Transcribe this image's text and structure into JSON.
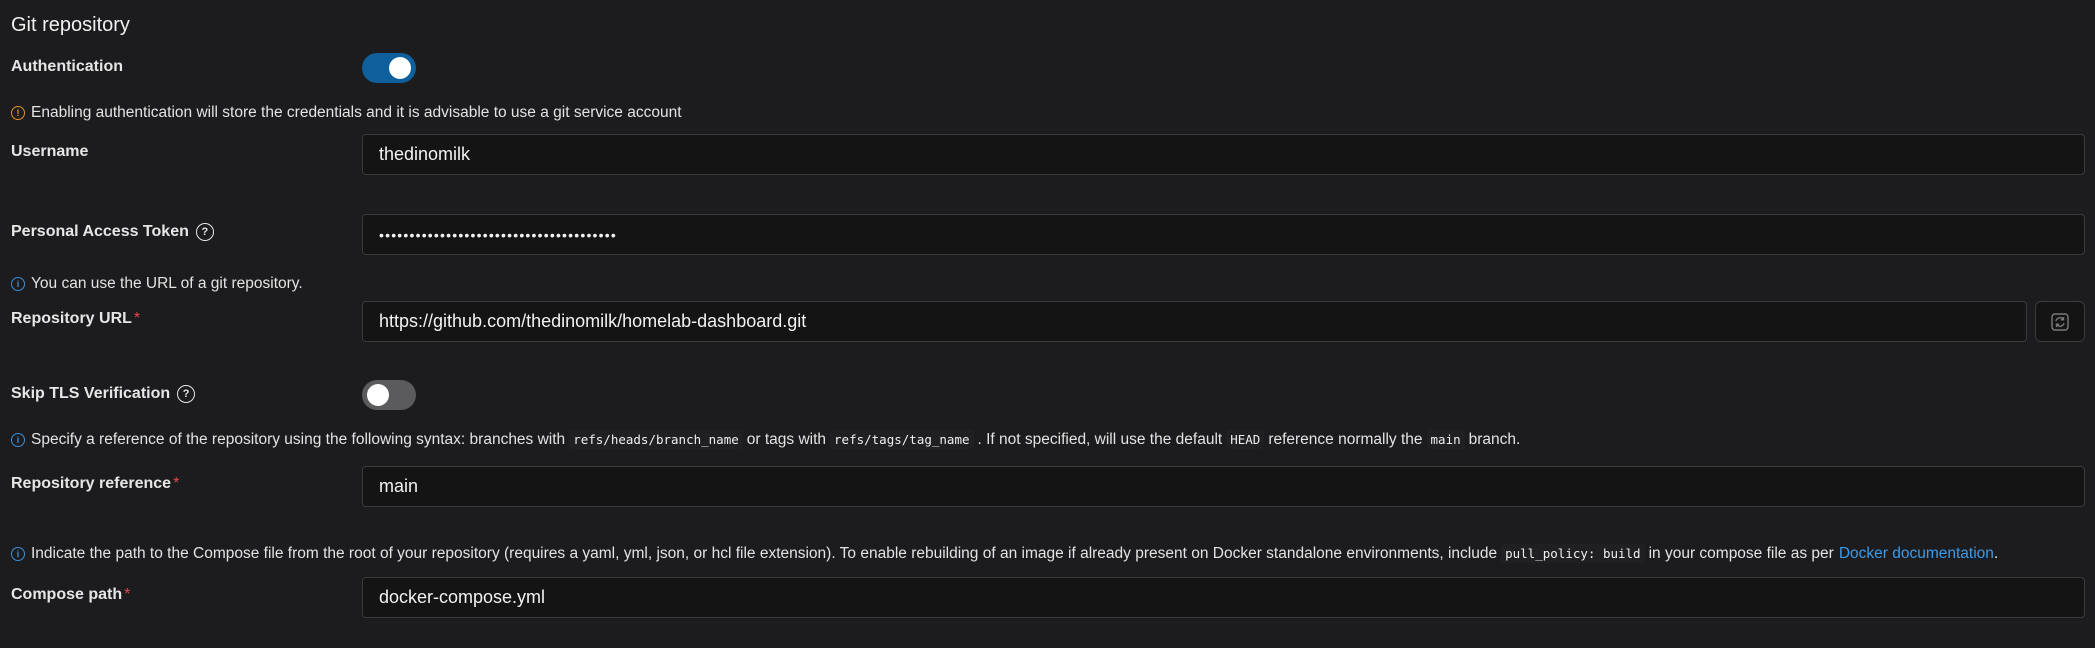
{
  "section": {
    "title": "Git repository"
  },
  "authentication": {
    "label": "Authentication",
    "enabled": true,
    "warning": "Enabling authentication will store the credentials and it is advisable to use a git service account"
  },
  "username": {
    "label": "Username",
    "value": "thedinomilk"
  },
  "token": {
    "label": "Personal Access Token",
    "value": "•••••••••••••••••••••••••••••••••••••••"
  },
  "repository_url": {
    "hint": "You can use the URL of a git repository.",
    "label": "Repository URL",
    "required_mark": "*",
    "value": "https://github.com/thedinomilk/homelab-dashboard.git",
    "refresh_icon": "refresh-icon"
  },
  "skip_tls": {
    "label": "Skip TLS Verification",
    "enabled": false
  },
  "reference": {
    "hint": {
      "part1": "Specify a reference of the repository using the following syntax: branches with",
      "code1": "refs/heads/branch_name",
      "part2": "or tags with",
      "code2": "refs/tags/tag_name",
      "part3": ". If not specified, will use the default",
      "code3": "HEAD",
      "part4": "reference normally the",
      "code4": "main",
      "part5": "branch."
    },
    "label": "Repository reference",
    "required_mark": "*",
    "value": "main"
  },
  "compose": {
    "hint": {
      "part1": "Indicate the path to the Compose file from the root of your repository (requires a yaml, yml, json, or hcl file extension).  To enable rebuilding of an image if already present on Docker standalone environments, include",
      "code1": "pull_policy: build",
      "part2": "in your compose file as per",
      "link": "Docker documentation",
      "part3": "."
    },
    "label": "Compose path",
    "required_mark": "*",
    "value": "docker-compose.yml"
  },
  "colors": {
    "background": "#1c1c1e",
    "toggle_on": "#0f5f9c",
    "warning": "#e4912b",
    "info": "#3b8fd6",
    "required": "#e0474c",
    "link": "#3b9ae8"
  }
}
